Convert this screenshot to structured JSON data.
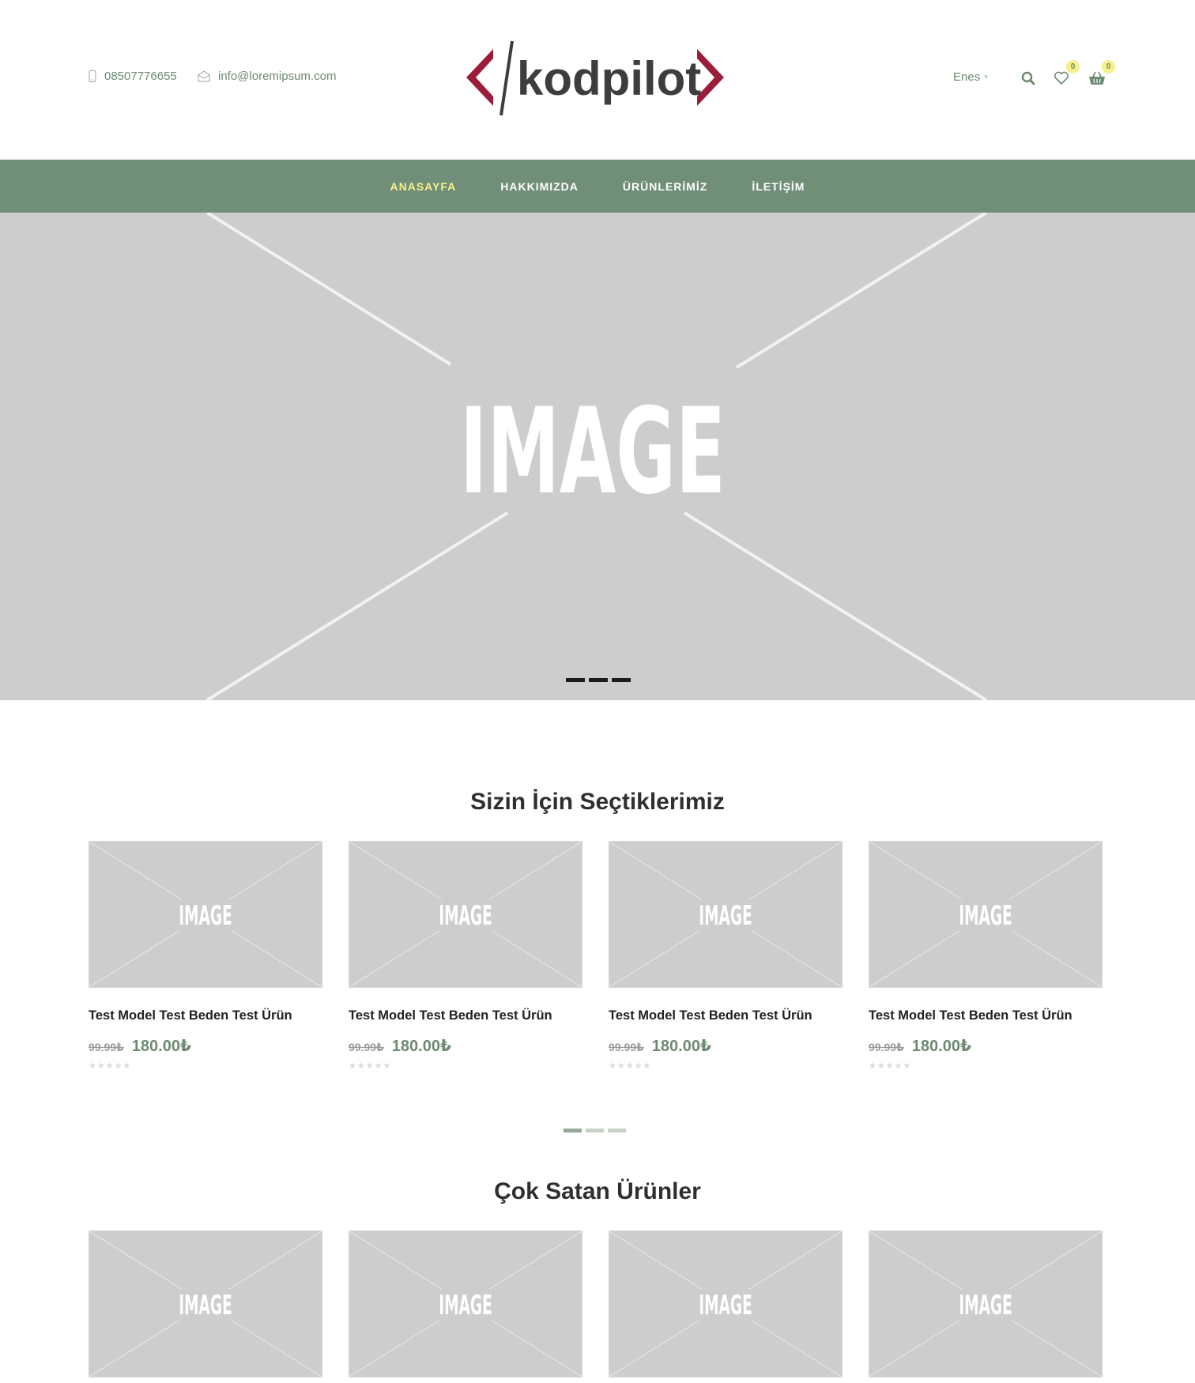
{
  "header": {
    "phone": "08507776655",
    "email": "info@loremipsum.com",
    "logo_text": "kodpilot",
    "user_name": "Enes",
    "wishlist_count": "0",
    "cart_count": "0"
  },
  "nav": {
    "items": [
      {
        "label": "ANASAYFA",
        "active": true
      },
      {
        "label": "HAKKIMIZDA",
        "active": false
      },
      {
        "label": "ÜRÜNLERİMİZ",
        "active": false
      },
      {
        "label": "İLETİŞİM",
        "active": false
      }
    ]
  },
  "hero": {
    "placeholder_text": "IMAGE",
    "slide_count": 3
  },
  "sections": [
    {
      "title": "Sizin İçin Seçtiklerimiz",
      "products": [
        {
          "image_text": "IMAGE",
          "name": "Test Model Test Beden Test Ürün",
          "old_price": "99.99₺",
          "price": "180.00₺"
        },
        {
          "image_text": "IMAGE",
          "name": "Test Model Test Beden Test Ürün",
          "old_price": "99.99₺",
          "price": "180.00₺"
        },
        {
          "image_text": "IMAGE",
          "name": "Test Model Test Beden Test Ürün",
          "old_price": "99.99₺",
          "price": "180.00₺"
        },
        {
          "image_text": "IMAGE",
          "name": "Test Model Test Beden Test Ürün",
          "old_price": "99.99₺",
          "price": "180.00₺"
        }
      ]
    },
    {
      "title": "Çok Satan Ürünler",
      "products": [
        {
          "image_text": "IMAGE"
        },
        {
          "image_text": "IMAGE"
        },
        {
          "image_text": "IMAGE"
        },
        {
          "image_text": "IMAGE"
        }
      ]
    }
  ],
  "colors": {
    "brand_green": "#718f78",
    "accent_yellow": "#f6f08c",
    "logo_red": "#9c1d3a",
    "logo_dark": "#3d3d3d",
    "placeholder_gray": "#cecdce"
  },
  "icons": {
    "phone": "phone-icon",
    "email": "mail-icon",
    "search": "search-icon",
    "wishlist": "heart-icon",
    "cart": "basket-icon",
    "user_caret": "chevron-down-icon",
    "rating": "star-icon"
  }
}
